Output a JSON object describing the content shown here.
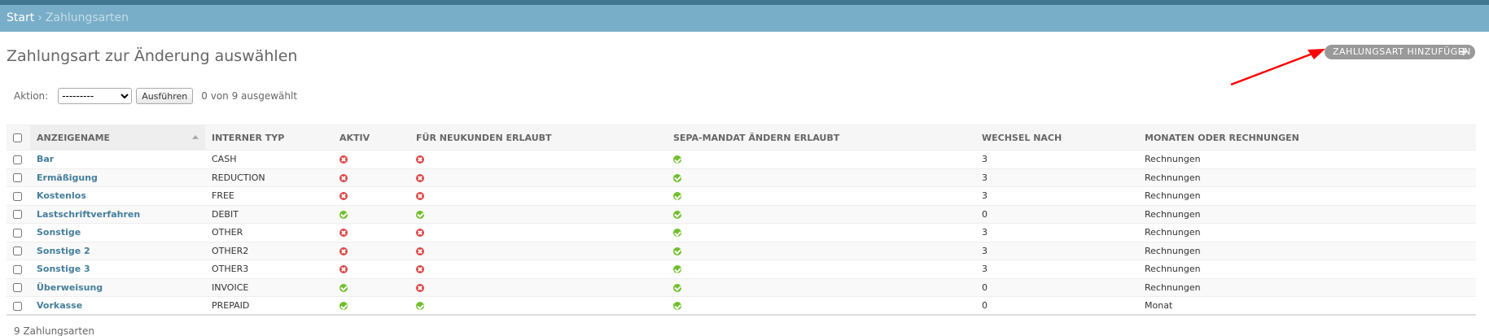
{
  "breadcrumbs": {
    "home": "Start",
    "separator": "›",
    "current": "Zahlungsarten"
  },
  "title": "Zahlungsart zur Änderung auswählen",
  "add_button": {
    "label": "Zahlungsart hinzufügen",
    "icon": "plus-icon"
  },
  "actions": {
    "label": "Aktion:",
    "select_value": "---------",
    "run_label": "Ausführen",
    "counter": "0 von 9 ausgewählt"
  },
  "table": {
    "columns": [
      "Anzeigename",
      "Interner Typ",
      "Aktiv",
      "Für Neukunden erlaubt",
      "SEPA-Mandat ändern erlaubt",
      "Wechsel nach",
      "Monaten oder Rechnungen"
    ],
    "rows": [
      {
        "name": "Bar",
        "type": "CASH",
        "aktiv": false,
        "neukunden": false,
        "sepa": true,
        "wechsel": "3",
        "einheit": "Rechnungen"
      },
      {
        "name": "Ermäßigung",
        "type": "REDUCTION",
        "aktiv": false,
        "neukunden": false,
        "sepa": true,
        "wechsel": "3",
        "einheit": "Rechnungen"
      },
      {
        "name": "Kostenlos",
        "type": "FREE",
        "aktiv": false,
        "neukunden": false,
        "sepa": true,
        "wechsel": "3",
        "einheit": "Rechnungen"
      },
      {
        "name": "Lastschriftverfahren",
        "type": "DEBIT",
        "aktiv": true,
        "neukunden": true,
        "sepa": true,
        "wechsel": "0",
        "einheit": "Rechnungen"
      },
      {
        "name": "Sonstige",
        "type": "OTHER",
        "aktiv": false,
        "neukunden": false,
        "sepa": true,
        "wechsel": "3",
        "einheit": "Rechnungen"
      },
      {
        "name": "Sonstige 2",
        "type": "OTHER2",
        "aktiv": false,
        "neukunden": false,
        "sepa": true,
        "wechsel": "3",
        "einheit": "Rechnungen"
      },
      {
        "name": "Sonstige 3",
        "type": "OTHER3",
        "aktiv": false,
        "neukunden": false,
        "sepa": true,
        "wechsel": "3",
        "einheit": "Rechnungen"
      },
      {
        "name": "Überweisung",
        "type": "INVOICE",
        "aktiv": true,
        "neukunden": false,
        "sepa": true,
        "wechsel": "0",
        "einheit": "Rechnungen"
      },
      {
        "name": "Vorkasse",
        "type": "PREPAID",
        "aktiv": true,
        "neukunden": true,
        "sepa": true,
        "wechsel": "0",
        "einheit": "Monat"
      }
    ]
  },
  "paginator": "9 Zahlungsarten",
  "colors": {
    "header": "#417690",
    "breadcrumb_bar": "#79aec8",
    "link": "#447e9b",
    "yes": "#70bf2b",
    "no": "#dd4646",
    "arrow": "#ff0000"
  },
  "annotation": {
    "icon": "red-arrow-icon"
  }
}
